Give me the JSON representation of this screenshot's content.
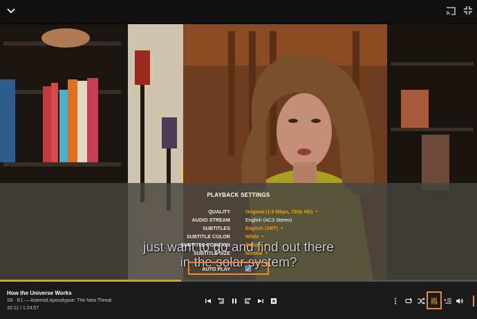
{
  "player": {
    "cast_icon": "cast-icon",
    "fullscreen_icon": "exit-fullscreen-icon",
    "collapse_icon": "chevron-down-icon"
  },
  "subtitle_lines": [
    "just want to go and find out there",
    "in the solar system?"
  ],
  "playback_settings": {
    "title": "PLAYBACK SETTINGS",
    "rows": [
      {
        "label": "QUALITY",
        "value": "Original (1.9 Mbps, 720p HD)",
        "dropdown": true
      },
      {
        "label": "AUDIO STREAM",
        "value": "English (AC3 Stereo)",
        "dropdown": false
      },
      {
        "label": "SUBTITLES",
        "value": "English (SRT)",
        "dropdown": true
      },
      {
        "label": "SUBTITLE COLOR",
        "value": "White",
        "dropdown": true
      },
      {
        "label": "SUBTITLE POSITION",
        "value": "Bottom",
        "dropdown": true
      },
      {
        "label": "SUBTITLE SIZE",
        "value": "Normal",
        "dropdown": true
      }
    ],
    "auto_play": {
      "label": "AUTO PLAY",
      "checked": true
    }
  },
  "now_playing": {
    "title": "How the Universe Works",
    "episode": "S8 · E1 — Asteroid Apocalypse: The New Threat",
    "time": "32:11 / 1:24:57",
    "progress_fraction": 0.379
  },
  "controls": [
    {
      "name": "skip-previous-button",
      "icon": "skip-previous-icon"
    },
    {
      "name": "rewind-button",
      "icon": "replay-10-icon"
    },
    {
      "name": "pause-button",
      "icon": "pause-icon"
    },
    {
      "name": "forward-button",
      "icon": "forward-30-icon"
    },
    {
      "name": "skip-next-button",
      "icon": "skip-next-icon"
    },
    {
      "name": "stop-button",
      "icon": "stop-icon"
    },
    {
      "name": "more-button",
      "icon": "more-vertical-icon"
    },
    {
      "name": "repeat-button",
      "icon": "repeat-icon"
    },
    {
      "name": "shuffle-button",
      "icon": "shuffle-icon"
    },
    {
      "name": "playback-settings-button",
      "icon": "equalizer-sliders-icon"
    },
    {
      "name": "playlist-button",
      "icon": "playlist-icon"
    },
    {
      "name": "volume-button",
      "icon": "volume-icon"
    }
  ],
  "colors": {
    "accent": "#e5a00d",
    "highlight": "#f08a24"
  }
}
